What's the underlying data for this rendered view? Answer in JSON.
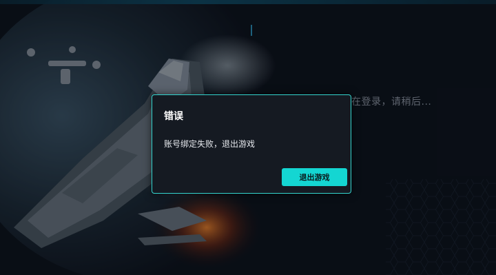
{
  "background": {
    "loading_text": "在登录，请稍后..."
  },
  "dialog": {
    "title": "错误",
    "message": "账号绑定失败，退出游戏",
    "button_label": "退出游戏"
  },
  "colors": {
    "accent": "#14d6d2",
    "dialog_bg": "#151a22",
    "page_bg": "#0c111a"
  }
}
